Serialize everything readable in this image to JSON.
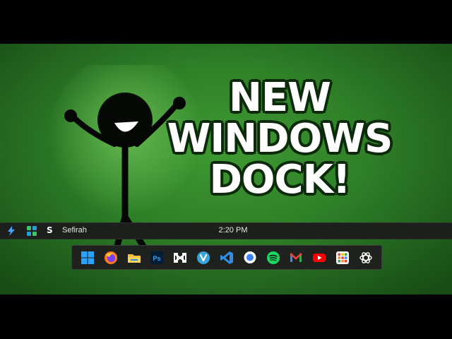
{
  "headline": {
    "line1": "NEW",
    "line2": "WINDOWS",
    "line3": "DOCK!"
  },
  "menubar": {
    "app_initial": "S",
    "app_name": "Sefirah",
    "clock": "2:20 PM",
    "left_icons": [
      "lightning-app-icon",
      "green-grid-app-icon"
    ]
  },
  "dock": {
    "items": [
      {
        "name": "windows-start-icon",
        "color": "#2aa3ff"
      },
      {
        "name": "firefox-icon",
        "color": "#ff7a1a"
      },
      {
        "name": "file-explorer-icon",
        "color": "#f3c23a"
      },
      {
        "name": "photoshop-icon",
        "label": "Ps",
        "color": "#31a8ff"
      },
      {
        "name": "capcut-icon",
        "color": "#ffffff"
      },
      {
        "name": "vivaldi-like-icon",
        "color": "#3aa3d8"
      },
      {
        "name": "vscode-icon",
        "color": "#2f8ee6"
      },
      {
        "name": "messenger-icon",
        "color": "#3b82f6"
      },
      {
        "name": "spotify-icon",
        "color": "#1ed760"
      },
      {
        "name": "gmail-icon",
        "color": "#ea4335"
      },
      {
        "name": "youtube-icon",
        "color": "#ff0000"
      },
      {
        "name": "app-grid-icon",
        "color": "#f28b30"
      },
      {
        "name": "chatgpt-icon",
        "color": "#ffffff"
      }
    ]
  }
}
